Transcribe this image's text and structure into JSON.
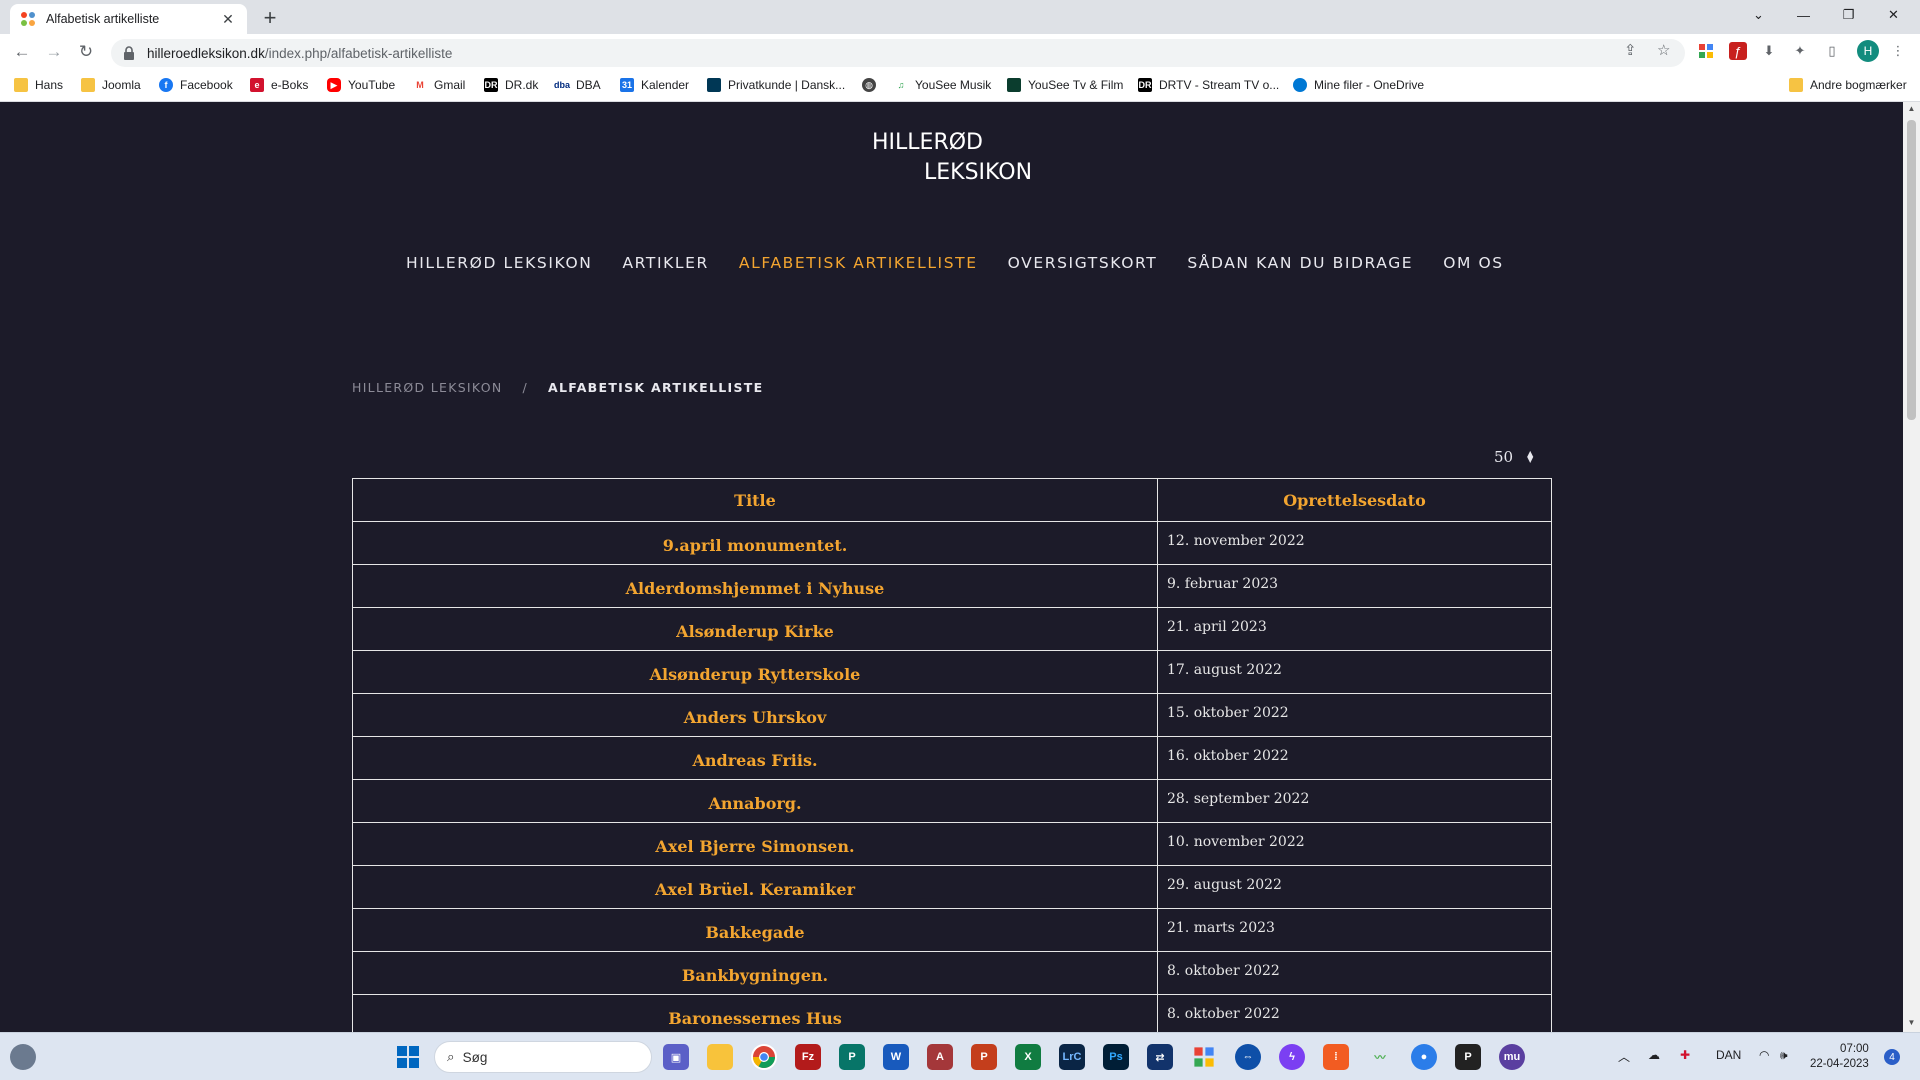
{
  "browser": {
    "tab_title": "Alfabetisk artikelliste",
    "url_host": "hilleroedleksikon.dk",
    "url_path": "/index.php/alfabetisk-artikelliste",
    "profile_initial": "H"
  },
  "bookmarks": [
    {
      "label": "Hans",
      "icon": "folder-icon"
    },
    {
      "label": "Joomla",
      "icon": "folder-icon"
    },
    {
      "label": "Facebook",
      "icon": "facebook-icon"
    },
    {
      "label": "e-Boks",
      "icon": "eboks-icon"
    },
    {
      "label": "YouTube",
      "icon": "youtube-icon"
    },
    {
      "label": "Gmail",
      "icon": "gmail-icon"
    },
    {
      "label": "DR.dk",
      "icon": "dr-icon"
    },
    {
      "label": "DBA",
      "icon": "dba-icon"
    },
    {
      "label": "Kalender",
      "icon": "calendar-icon"
    },
    {
      "label": "Privatkunde | Dansk...",
      "icon": "bank-icon"
    },
    {
      "label": "",
      "icon": "globe-icon"
    },
    {
      "label": "YouSee Musik",
      "icon": "music-icon"
    },
    {
      "label": "YouSee Tv & Film",
      "icon": "yousee-icon"
    },
    {
      "label": "DRTV - Stream TV o...",
      "icon": "drtv-icon"
    },
    {
      "label": "Mine filer - OneDrive",
      "icon": "onedrive-icon"
    }
  ],
  "other_bookmarks": "Andre bogmærker",
  "site": {
    "logo_line1": "HILLERØD",
    "logo_line2": "LEKSIKON",
    "nav": [
      {
        "label": "HILLERØD LEKSIKON",
        "active": false
      },
      {
        "label": "ARTIKLER",
        "active": false
      },
      {
        "label": "ALFABETISK ARTIKELLISTE",
        "active": true
      },
      {
        "label": "OVERSIGTSKORT",
        "active": false
      },
      {
        "label": "SÅDAN KAN DU BIDRAGE",
        "active": false
      },
      {
        "label": "OM OS",
        "active": false
      }
    ],
    "breadcrumb": {
      "home": "HILLERØD LEKSIKON",
      "separator": "/",
      "current": "ALFABETISK ARTIKELLISTE"
    },
    "limit_value": "50",
    "table": {
      "headers": [
        "Title",
        "Oprettelsesdato"
      ],
      "rows": [
        {
          "title": "9.april monumentet.",
          "date": "12. november 2022"
        },
        {
          "title": "Alderdomshjemmet i Nyhuse",
          "date": "9. februar 2023"
        },
        {
          "title": "Alsønderup Kirke",
          "date": "21. april 2023"
        },
        {
          "title": "Alsønderup Rytterskole",
          "date": "17. august 2022"
        },
        {
          "title": "Anders Uhrskov",
          "date": "15. oktober 2022"
        },
        {
          "title": "Andreas Friis.",
          "date": "16. oktober 2022"
        },
        {
          "title": "Annaborg.",
          "date": "28. september 2022"
        },
        {
          "title": "Axel Bjerre Simonsen.",
          "date": "10. november 2022"
        },
        {
          "title": "Axel Brüel. Keramiker",
          "date": "29. august 2022"
        },
        {
          "title": "Bakkegade",
          "date": "21. marts 2023"
        },
        {
          "title": "Bankbygningen.",
          "date": "8. oktober 2022"
        },
        {
          "title": "Baronessernes Hus",
          "date": "8. oktober 2022"
        }
      ]
    }
  },
  "taskbar": {
    "search_placeholder": "Søg",
    "lang": "DAN",
    "time": "07:00",
    "date": "22-04-2023",
    "notifications": "4"
  },
  "colors": {
    "accent": "#f3a530",
    "page_bg": "#1c1b29"
  }
}
